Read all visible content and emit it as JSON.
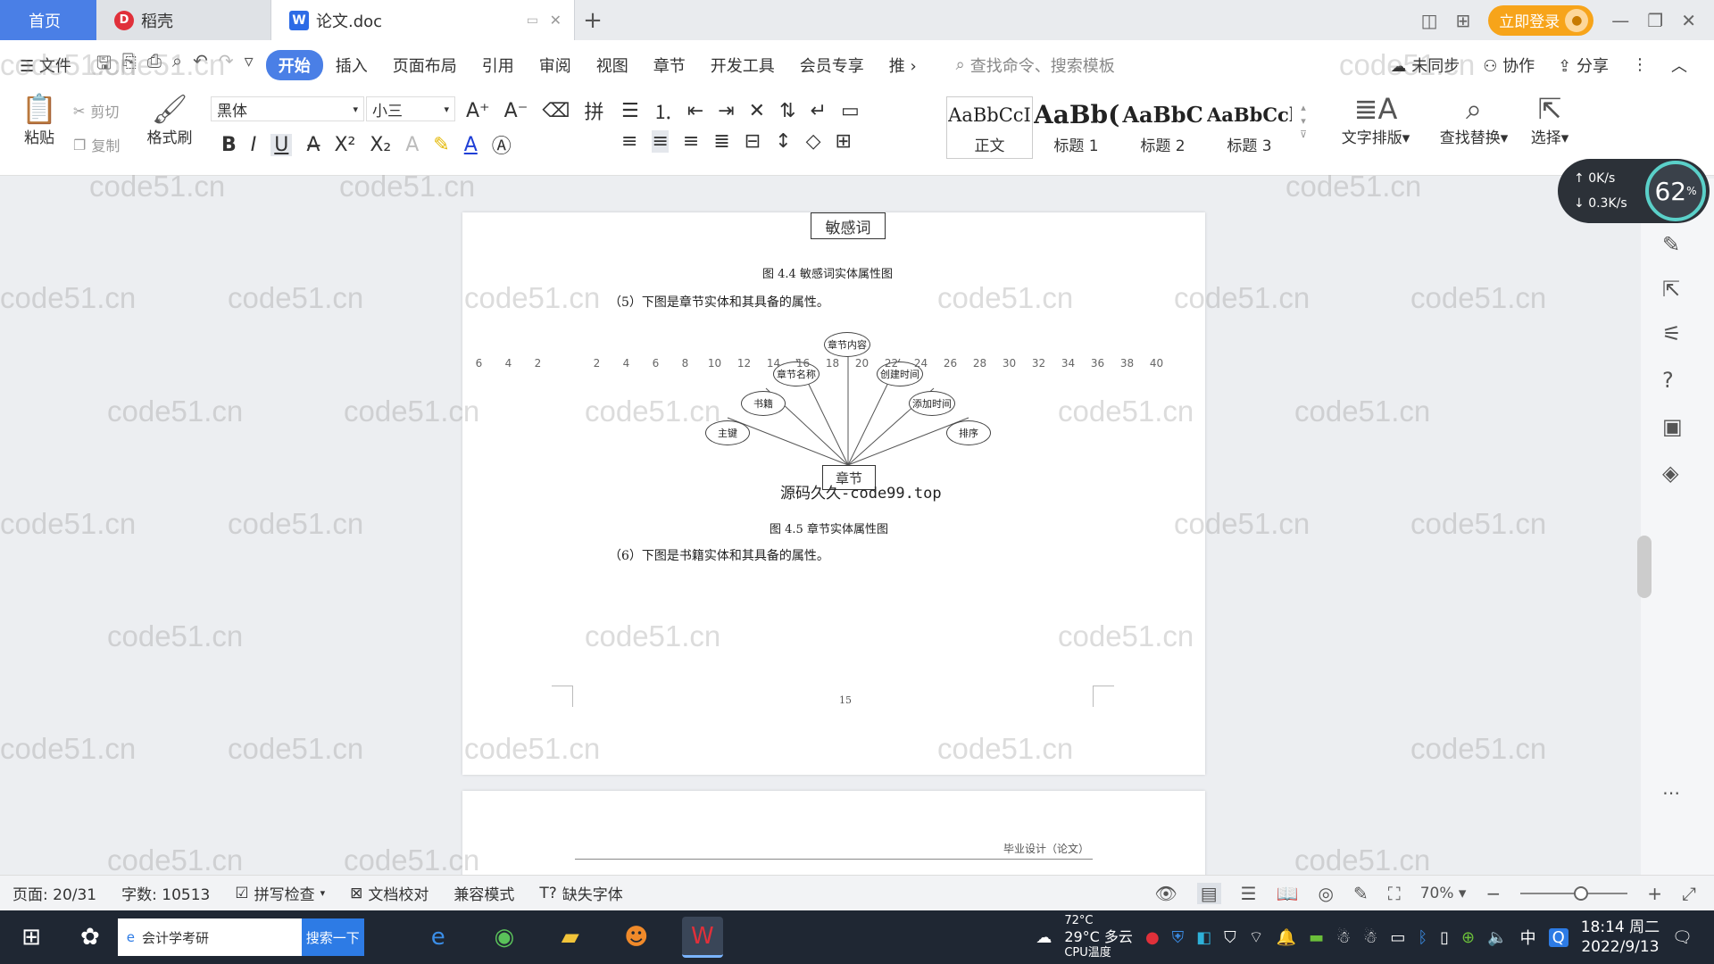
{
  "tabs": {
    "home": "首页",
    "daoke": "稻壳",
    "doc": "论文.doc",
    "login": "立即登录"
  },
  "menu": {
    "file": "文件",
    "items": [
      "开始",
      "插入",
      "页面布局",
      "引用",
      "审阅",
      "视图",
      "章节",
      "开发工具",
      "会员专享",
      "推"
    ],
    "search_cmd": "查找命令、搜索模板",
    "unsynced": "未同步",
    "collab": "协作",
    "share": "分享"
  },
  "ribbon": {
    "paste": "粘贴",
    "cut": "剪切",
    "copy": "复制",
    "format_painter": "格式刷",
    "font_name": "黑体",
    "font_size": "小三",
    "styles": [
      {
        "preview": "AaBbCcI",
        "name": "正文"
      },
      {
        "preview": "AaBb(",
        "name": "标题 1"
      },
      {
        "preview": "AaBbC",
        "name": "标题 2"
      },
      {
        "preview": "AaBbCcl",
        "name": "标题 3"
      }
    ],
    "text_layout": "文字排版",
    "find_replace": "查找替换",
    "select": "选择"
  },
  "ruler": [
    "6",
    "4",
    "2",
    "",
    "2",
    "4",
    "6",
    "8",
    "10",
    "12",
    "14",
    "16",
    "18",
    "20",
    "22",
    "24",
    "26",
    "28",
    "30",
    "32",
    "34",
    "36",
    "38",
    "40"
  ],
  "speed": {
    "up": "0",
    "down": "0.3",
    "unit": "K/s",
    "cpu": "62"
  },
  "document": {
    "entity_top": "敏感词",
    "caption_44": "图 4.4 敏感词实体属性图",
    "para_5": "（5）下图是章节实体和其具备的属性。",
    "er": {
      "entity": "章节",
      "attributes": [
        "章节内容",
        "章节名称",
        "创建时间",
        "书籍",
        "添加时间",
        "主键",
        "排序"
      ]
    },
    "overlay": "源码久久-code99.top",
    "caption_45": "图 4.5 章节实体属性图",
    "para_6": "（6）下图是书籍实体和其具备的属性。",
    "page_number": "15",
    "next_header": "毕业设计（论文）"
  },
  "watermark": "code51.cn",
  "status": {
    "page": "页面: 20/31",
    "words": "字数: 10513",
    "spell": "拼写检查",
    "proof": "文档校对",
    "compat": "兼容模式",
    "missing_font": "缺失字体",
    "zoom": "70%"
  },
  "taskbar": {
    "search": "会计学考研",
    "search_btn": "搜索一下",
    "weather_temp": "29°C 多云",
    "cpu_temp": "72°C",
    "cpu_label": "CPU温度",
    "ime": "中",
    "time": "18:14 周二",
    "date": "2022/9/13"
  }
}
